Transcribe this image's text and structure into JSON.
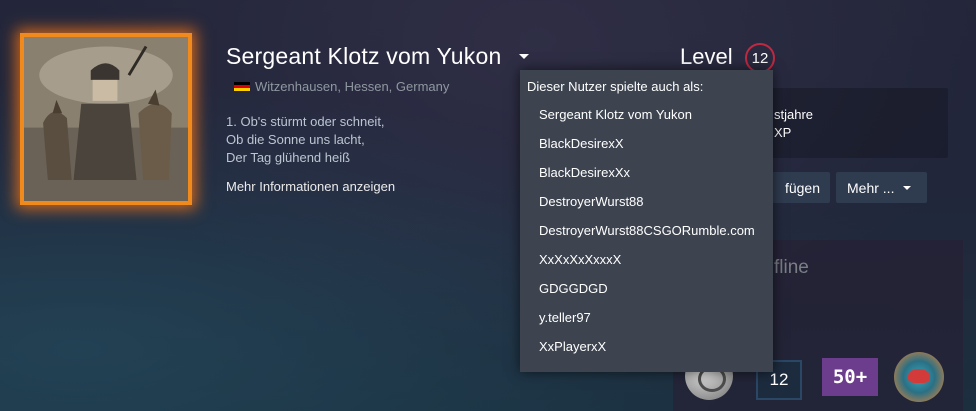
{
  "profile": {
    "persona_name": "Sergeant Klotz vom Yukon",
    "location": "Witzenhausen, Hessen, Germany",
    "summary": [
      "1. Ob's stürmt oder schneit,",
      "Ob die Sonne uns lacht,",
      "Der Tag glühend heiß"
    ],
    "more_info_label": "Mehr Informationen anzeigen"
  },
  "level": {
    "label": "Level",
    "value": "12"
  },
  "years_box": {
    "years_text_partial": "stjahre",
    "xp_text_partial": "XP"
  },
  "actions": {
    "add_label_partial": "fügen",
    "more_label": "Mehr ..."
  },
  "status": {
    "text_partial": "fline"
  },
  "badges": {
    "level_badge": "12",
    "fifty_badge": "50+"
  },
  "alias_dropdown": {
    "header": "Dieser Nutzer spielte auch als:",
    "aliases": [
      "Sergeant Klotz vom Yukon",
      "BlackDesirexX",
      "BlackDesirexXx",
      "DestroyerWurst88",
      "DestroyerWurst88CSGORumble.com",
      "XxXxXxXxxxX",
      "GDGGDGD",
      "y.teller97",
      "XxPlayerxX"
    ]
  },
  "colors": {
    "avatar_frame": "#f08a1c",
    "level_ring": "#c02942",
    "dropdown_bg": "#3d4450",
    "button_bg": "#2f3b4f"
  },
  "icons": {
    "persona_caret": "caret-down-icon",
    "flag": "germany-flag-icon",
    "more_caret": "caret-down-icon"
  }
}
